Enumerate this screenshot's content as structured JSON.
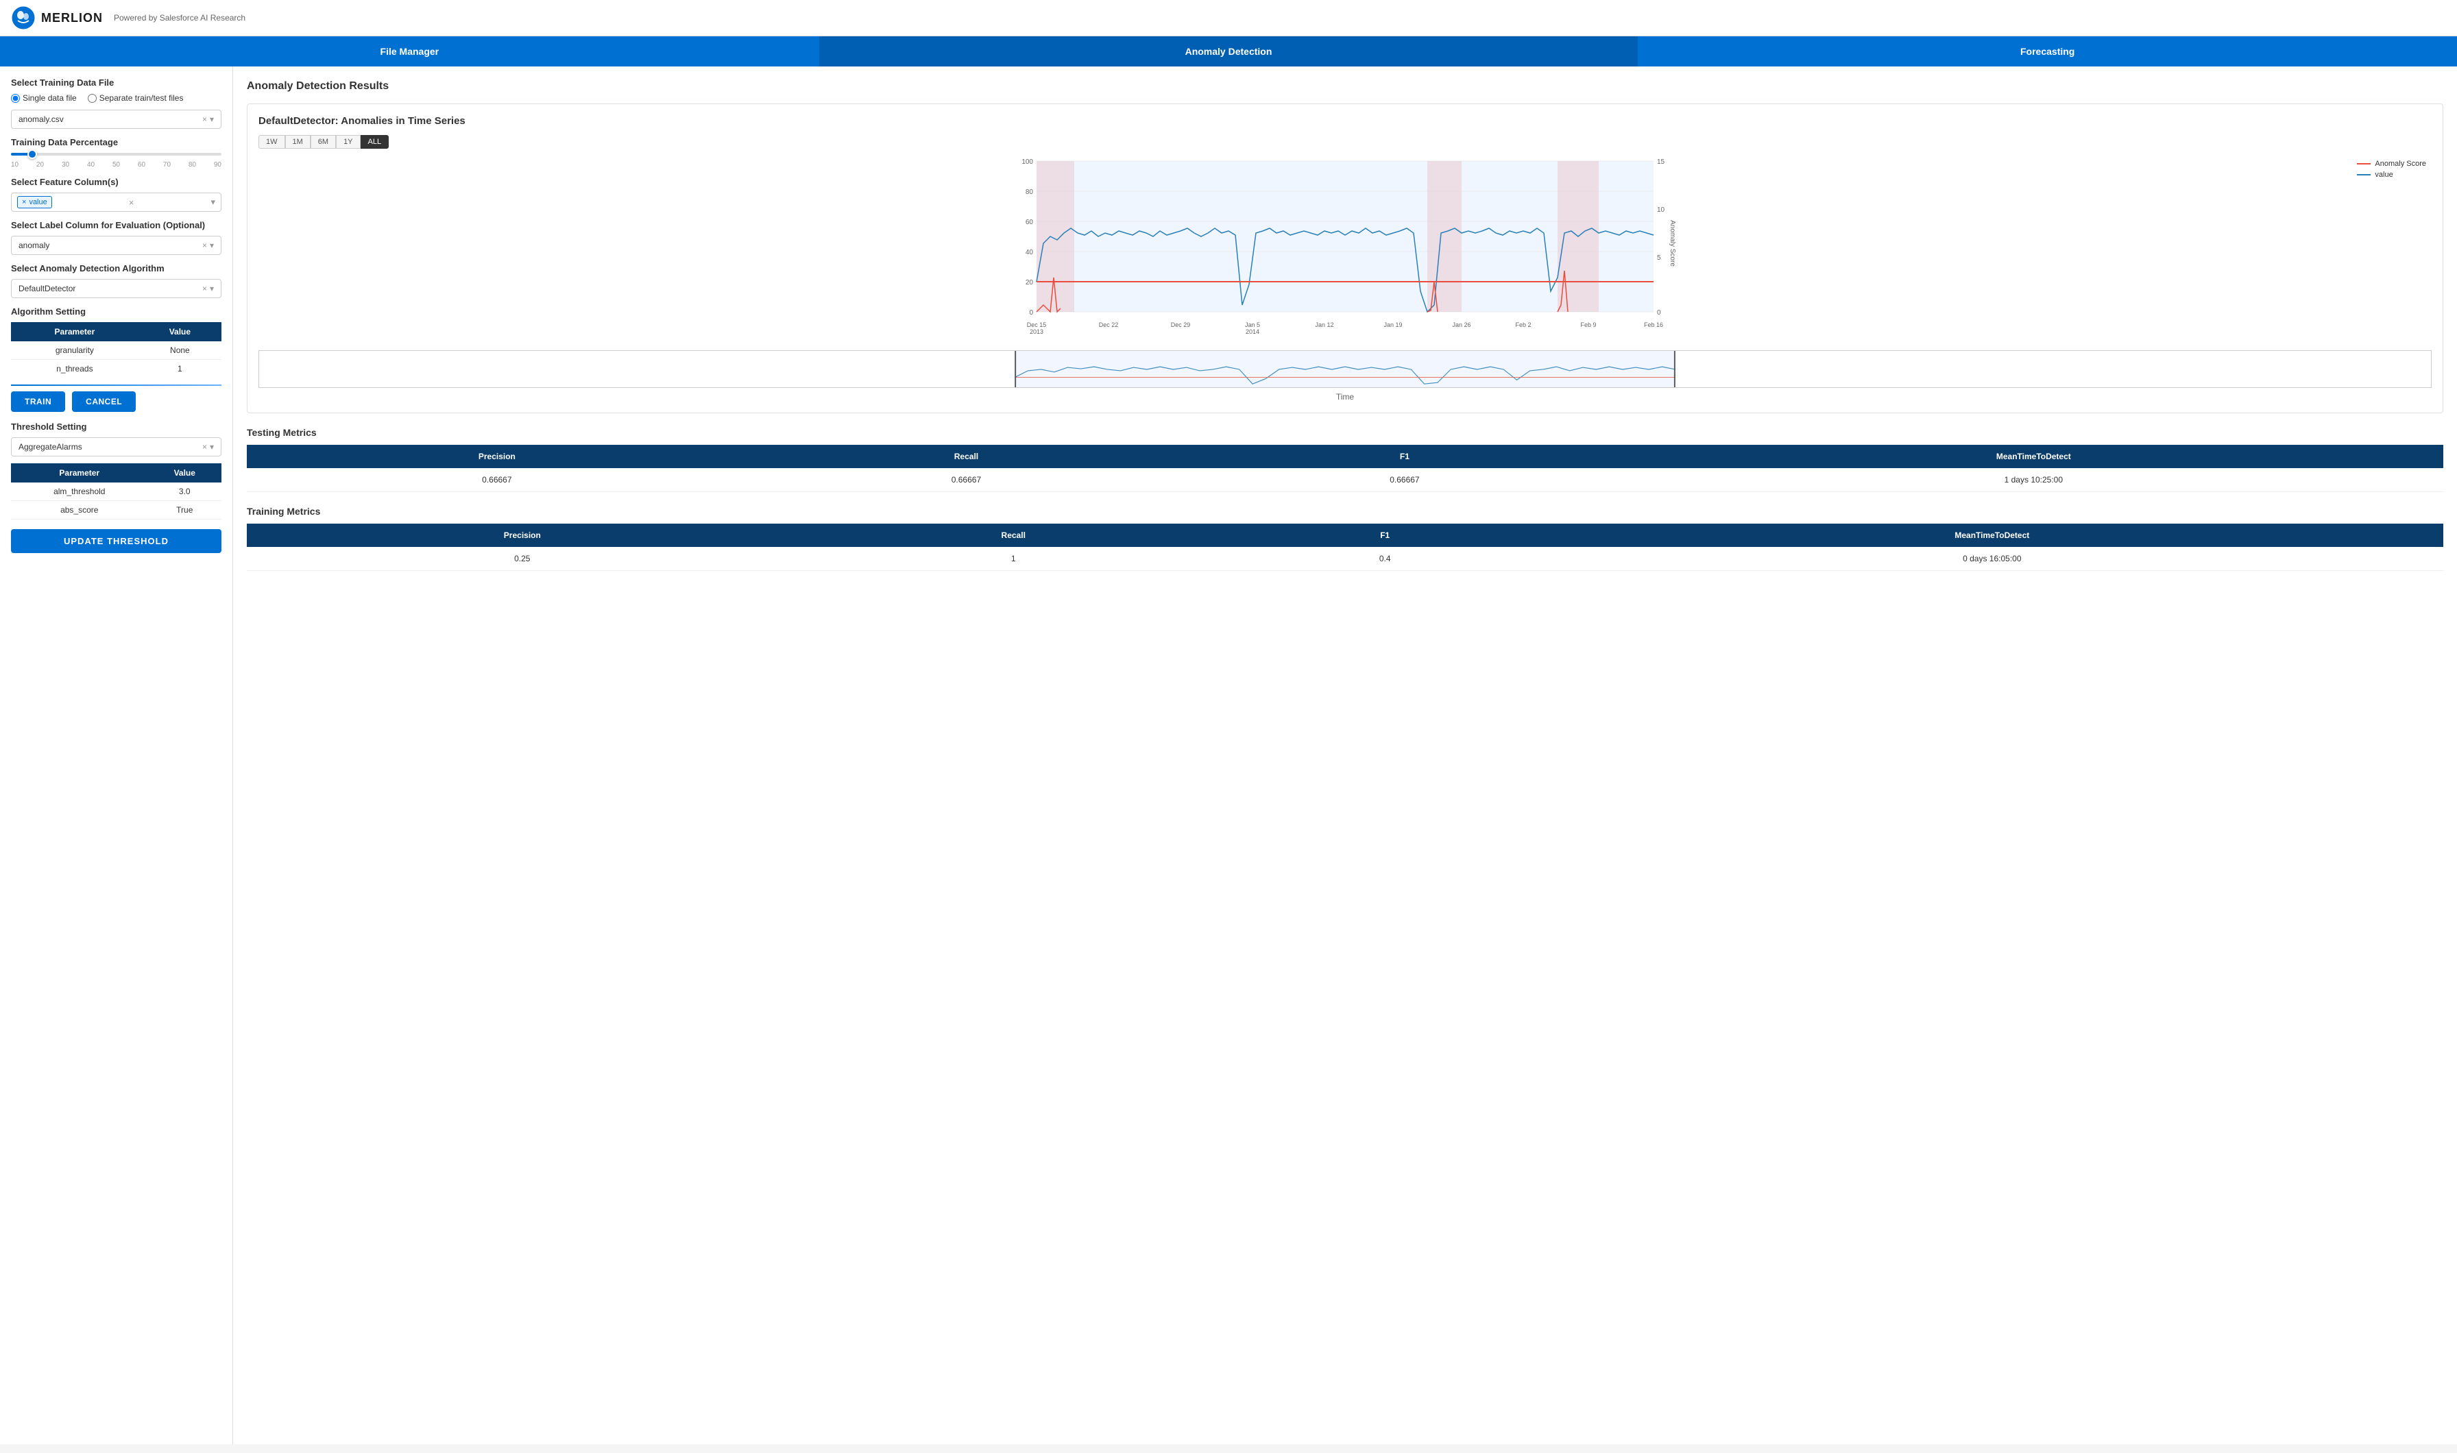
{
  "header": {
    "title": "MERLION",
    "subtitle": "Powered by Salesforce AI Research",
    "logo_alt": "merlion-logo"
  },
  "nav": {
    "tabs": [
      {
        "label": "File Manager",
        "active": false
      },
      {
        "label": "Anomaly Detection",
        "active": true
      },
      {
        "label": "Forecasting",
        "active": false
      }
    ]
  },
  "sidebar": {
    "training_data": {
      "label": "Select Training Data File",
      "radio_options": [
        "Single data file",
        "Separate train/test files"
      ],
      "selected_radio": "Single data file",
      "file_value": "anomaly.csv"
    },
    "training_percentage": {
      "label": "Training Data Percentage",
      "value": 10,
      "min": 10,
      "max": 90,
      "marks": [
        "10",
        "20",
        "30",
        "40",
        "50",
        "60",
        "70",
        "80",
        "90"
      ]
    },
    "feature_column": {
      "label": "Select Feature Column(s)",
      "selected": "value"
    },
    "label_column": {
      "label": "Select Label Column for Evaluation (Optional)",
      "selected": "anomaly"
    },
    "algorithm": {
      "label": "Select Anomaly Detection Algorithm",
      "selected": "DefaultDetector"
    },
    "algorithm_setting": {
      "label": "Algorithm Setting",
      "headers": [
        "Parameter",
        "Value"
      ],
      "rows": [
        {
          "parameter": "granularity",
          "value": "None"
        },
        {
          "parameter": "n_threads",
          "value": "1"
        }
      ]
    },
    "buttons": {
      "train": "TRAIN",
      "cancel": "CANCEL"
    },
    "threshold_setting": {
      "label": "Threshold Setting",
      "selected": "AggregateAlarms",
      "headers": [
        "Parameter",
        "Value"
      ],
      "rows": [
        {
          "parameter": "alm_threshold",
          "value": "3.0"
        },
        {
          "parameter": "abs_score",
          "value": "True"
        }
      ]
    },
    "update_threshold_btn": "UPDATE THRESHOLD"
  },
  "content": {
    "section_title": "Anomaly Detection Results",
    "chart": {
      "title": "DefaultDetector: Anomalies in Time Series",
      "time_buttons": [
        "1W",
        "1M",
        "6M",
        "1Y",
        "ALL"
      ],
      "active_time": "ALL",
      "legend": [
        {
          "label": "Anomaly Score",
          "color": "#e74c3c"
        },
        {
          "label": "value",
          "color": "#2980b9"
        }
      ],
      "x_axis_labels": [
        "Dec 15\n2013",
        "Dec 22",
        "Dec 29",
        "Jan 5\n2014",
        "Jan 12",
        "Jan 19",
        "Jan 26",
        "Feb 2",
        "Feb 9",
        "Feb 16"
      ],
      "y_axis_left": [
        "0",
        "20",
        "40",
        "60",
        "80",
        "100"
      ],
      "y_axis_right": [
        "0",
        "5",
        "10",
        "15"
      ],
      "x_label": "Time"
    },
    "testing_metrics": {
      "title": "Testing Metrics",
      "headers": [
        "Precision",
        "Recall",
        "F1",
        "MeanTimeToDetect"
      ],
      "rows": [
        {
          "precision": "0.66667",
          "recall": "0.66667",
          "f1": "0.66667",
          "mean_time": "1 days 10:25:00"
        }
      ]
    },
    "training_metrics": {
      "title": "Training Metrics",
      "headers": [
        "Precision",
        "Recall",
        "F1",
        "MeanTimeToDetect"
      ],
      "rows": [
        {
          "precision": "0.25",
          "recall": "1",
          "f1": "0.4",
          "mean_time": "0 days 16:05:00"
        }
      ]
    }
  }
}
